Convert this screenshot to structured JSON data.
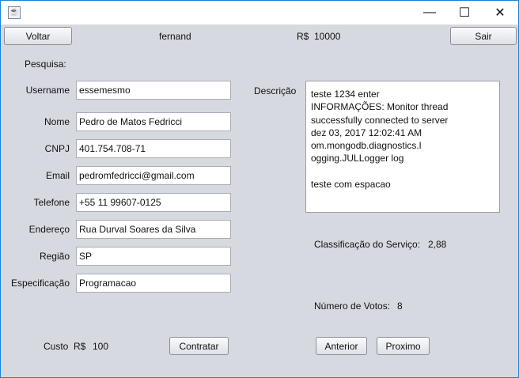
{
  "window": {
    "minimize": "—",
    "maximize": "☐",
    "close": "✕"
  },
  "header": {
    "back_label": "Voltar",
    "user": "fernand",
    "balance": "R$  10000",
    "exit_label": "Sair"
  },
  "search_label": "Pesquisa:",
  "fields": [
    {
      "label": "Username",
      "value": "essemesmo"
    },
    {
      "label": "Nome",
      "value": "Pedro de Matos Fedricci"
    },
    {
      "label": "CNPJ",
      "value": "401.754.708-71"
    },
    {
      "label": "Email",
      "value": "pedromfedricci@gmail.com"
    },
    {
      "label": "Telefone",
      "value": "+55 11 99607-0125"
    },
    {
      "label": "Endereço",
      "value": "Rua Durval Soares da Silva"
    },
    {
      "label": "Região",
      "value": "SP"
    },
    {
      "label": "Especificação",
      "value": "Programacao"
    }
  ],
  "description": {
    "label": "Descrição",
    "text": "teste 1234 enter\nINFORMAÇÕES: Monitor thread\nsuccessfully connected to server\ndez 03, 2017 12:02:41 AM\nom.mongodb.diagnostics.l\nogging.JULLogger log\n\nteste com espacao"
  },
  "rating": {
    "label": "Classificação do Serviço:",
    "value": "2,88"
  },
  "votes": {
    "label": "Número de Votos:",
    "value": "8"
  },
  "cost": {
    "label": "Custo  R$",
    "value": "100"
  },
  "buttons": {
    "hire": "Contratar",
    "previous": "Anterior",
    "next": "Proximo"
  }
}
